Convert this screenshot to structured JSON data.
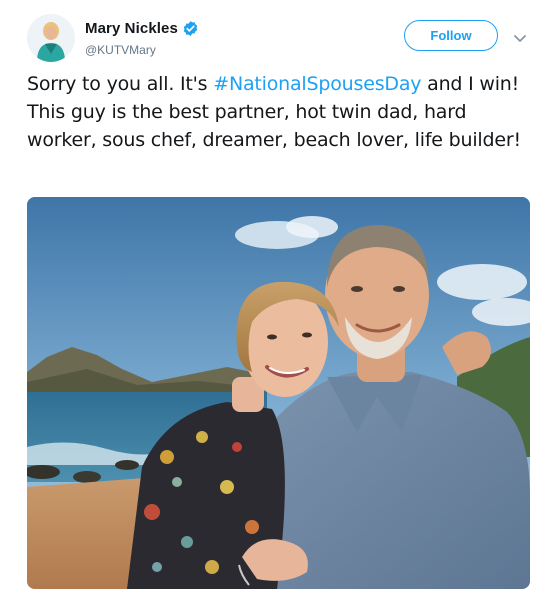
{
  "author": {
    "display_name": "Mary Nickles",
    "handle": "@KUTVMary",
    "verified": true,
    "avatar_icon": "profile-avatar"
  },
  "follow_button": {
    "label": "Follow"
  },
  "menu": {
    "icon": "chevron-down-icon"
  },
  "tweet": {
    "text_before": "Sorry to you all. It's ",
    "hashtag": "#NationalSpousesDay",
    "text_after": " and I win! This guy is the best partner, hot twin dad, hard worker, sous chef, dreamer, beach lover, life builder!"
  },
  "media": {
    "type": "photo"
  },
  "colors": {
    "accent": "#1da1f2",
    "text": "#14171a",
    "secondary_text": "#657786"
  }
}
